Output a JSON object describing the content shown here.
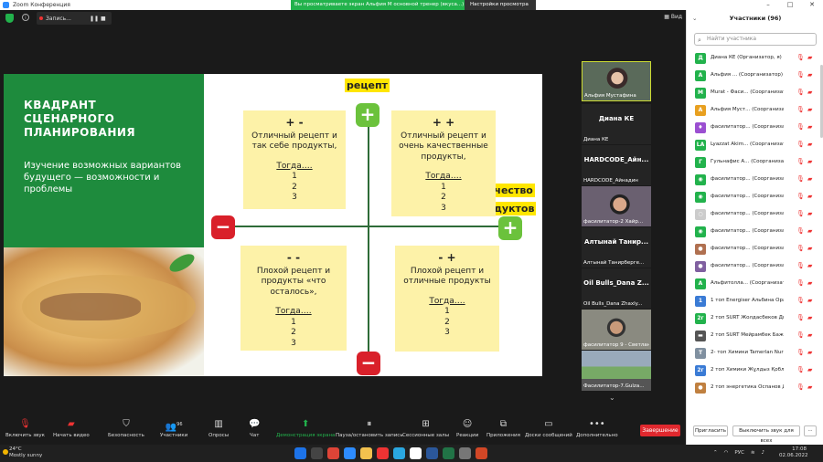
{
  "window": {
    "title": "Zoom Конференция",
    "view_label": "Вид"
  },
  "recording": {
    "label": "Запись..."
  },
  "share_banner": {
    "message": "Вы просматриваете экран Альфия М основной тренер (вкуса...)",
    "options": "Настройки просмотра"
  },
  "slide": {
    "heading": "КВАДРАНТ СЦЕНАРНОГО ПЛАНИРОВАНИЯ",
    "subtitle": "Изучение возможных вариантов будущего — возможности и проблемы",
    "axis_top": "рецепт",
    "axis_right_line1": "Качество",
    "axis_right_line2": "продуктов",
    "quadrants": [
      {
        "sign": "+ -",
        "text": "Отличный рецепт и так себе продукты,",
        "then": "Тогда….",
        "items": [
          "1",
          "2",
          "3"
        ]
      },
      {
        "sign": "+ +",
        "text": "Отличный рецепт и очень качественные продукты,",
        "then": "Тогда….",
        "items": [
          "1",
          "2",
          "3"
        ]
      },
      {
        "sign": "- -",
        "text": "Плохой рецепт и продукты «что осталось»,",
        "then": "Тогда….",
        "items": [
          "1",
          "2",
          "3"
        ]
      },
      {
        "sign": "- +",
        "text": "Плохой рецепт и отличные продукты",
        "then": "Тогда….",
        "items": [
          "1",
          "2",
          "3"
        ]
      }
    ]
  },
  "videos": [
    {
      "name": "Альфия Мустафина",
      "big": ""
    },
    {
      "name": "Диана КЕ",
      "big": "Диана КЕ"
    },
    {
      "name": "HARDCODE_Айнадин",
      "big": "HARDCODE_Айн..."
    },
    {
      "name": "фасилитатор-2 Хайр...",
      "big": ""
    },
    {
      "name": "Алтынай Танирберге...",
      "big": "Алтынай Танир..."
    },
    {
      "name": "Oil Bulls_Dana Zhaxly...",
      "big": "Oil Bulls_Dana Z..."
    },
    {
      "name": "фасилитатор 9 - Светлан...",
      "big": ""
    },
    {
      "name": "Фасилитатор-7.Gulza...",
      "big": ""
    }
  ],
  "toolbar": {
    "mute": "Включить звук",
    "video": "Начать видео",
    "security": "Безопасность",
    "participants": "Участники",
    "participants_count": "96",
    "polls": "Опросы",
    "chat": "Чат",
    "share": "Демонстрация экрана",
    "pause_rec": "Пауза/остановить запись",
    "breakout": "Сессионные залы",
    "reactions": "Реакции",
    "apps": "Приложения",
    "whiteboard": "Доски сообщений",
    "more": "Дополнительно",
    "end": "Завершение"
  },
  "panel": {
    "title": "Участники (96)",
    "search_placeholder": "Найти участника",
    "participants": [
      {
        "initial": "Д",
        "name": "Диана КЕ (Организатор, я)",
        "color": "#22b24c"
      },
      {
        "initial": "А",
        "name": "Альфия ... (Соорганизатор)",
        "color": "#22b24c"
      },
      {
        "initial": "M",
        "name": "Murat - Фаси... (Соорганизатор)",
        "color": "#22b24c"
      },
      {
        "initial": "А",
        "name": "Альфия Муст... (Соорганизатор)",
        "color": "#e8a020"
      },
      {
        "initial": "♦",
        "name": "фасилитатор... (Соорганизатор)",
        "color": "#9b4fd1"
      },
      {
        "initial": "LA",
        "name": "Lyazzat Akim... (Соорганизатор)",
        "color": "#22b24c"
      },
      {
        "initial": "Г",
        "name": "Гульнафис А... (Соорганизатор)",
        "color": "#22b24c"
      },
      {
        "initial": "◉",
        "name": "фасилитатор... (Соорганизатор)",
        "color": "#22b24c"
      },
      {
        "initial": "◉",
        "name": "фасилитатор... (Соорганизатор)",
        "color": "#22b24c"
      },
      {
        "initial": "○",
        "name": "фасилитатор... (Соорганизатор)",
        "color": "#cccccc"
      },
      {
        "initial": "◉",
        "name": "фасилитатор... (Соорганизатор)",
        "color": "#22b24c"
      },
      {
        "initial": "●",
        "name": "фасилитатор... (Соорганизатор)",
        "color": "#b07050"
      },
      {
        "initial": "●",
        "name": "фасилитатор... (Соорганизатор)",
        "color": "#8060a0"
      },
      {
        "initial": "А",
        "name": "Альфитолла... (Соорганизатор)",
        "color": "#22b24c"
      },
      {
        "initial": "1",
        "name": "1 топ Energiser Альбина Ораз...",
        "color": "#3a7bd5"
      },
      {
        "initial": "2г",
        "name": "2 топ SURT Жолдасбеков Диас",
        "color": "#22b24c"
      },
      {
        "initial": "▬",
        "name": "2 топ SURT Мейрамбек Бaжан",
        "color": "#555555"
      },
      {
        "initial": "Т",
        "name": "2- топ Химики Tamerlan Nurla...",
        "color": "#8090a0"
      },
      {
        "initial": "2г",
        "name": "2 топ Химики Жұлдыз Қоблан...",
        "color": "#3a7bd5"
      },
      {
        "initial": "●",
        "name": "2 топ энергетика Оспанов Диас",
        "color": "#c08040"
      }
    ],
    "invite": "Пригласить",
    "unmute_all": "Выключить звук для всех"
  },
  "taskbar": {
    "temp": "24°C",
    "weather": "Mostly sunny",
    "lang": "РУС",
    "time": "17:08",
    "date": "02.06.2022"
  }
}
